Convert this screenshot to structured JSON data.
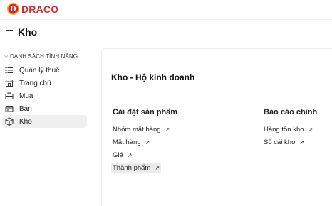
{
  "brand": {
    "logo_letter": "D",
    "name": "DRACO",
    "color": "#d8262c"
  },
  "header": {
    "title": "Kho"
  },
  "sidebar": {
    "section_title": "DANH SÁCH TÍNH NĂNG",
    "items": [
      {
        "label": "Quản lý thuế",
        "icon": "list-icon"
      },
      {
        "label": "Trang chủ",
        "icon": "store-icon"
      },
      {
        "label": "Mua",
        "icon": "briefcase-icon"
      },
      {
        "label": "Bán",
        "icon": "card-icon"
      },
      {
        "label": "Kho",
        "icon": "box-icon",
        "active": true
      }
    ]
  },
  "main": {
    "title": "Kho - Hộ kinh doanh",
    "columns": [
      {
        "title": "Cài đặt sản phẩm",
        "links": [
          {
            "label": "Nhóm mặt hàng"
          },
          {
            "label": "Mặt hàng"
          },
          {
            "label": "Giá"
          },
          {
            "label": "Thành phẩm",
            "highlighted": true
          }
        ]
      },
      {
        "title": "Báo cáo chính",
        "links": [
          {
            "label": "Hàng tồn kho"
          },
          {
            "label": "Sổ cái kho"
          }
        ]
      }
    ],
    "link_arrow": "↗"
  }
}
